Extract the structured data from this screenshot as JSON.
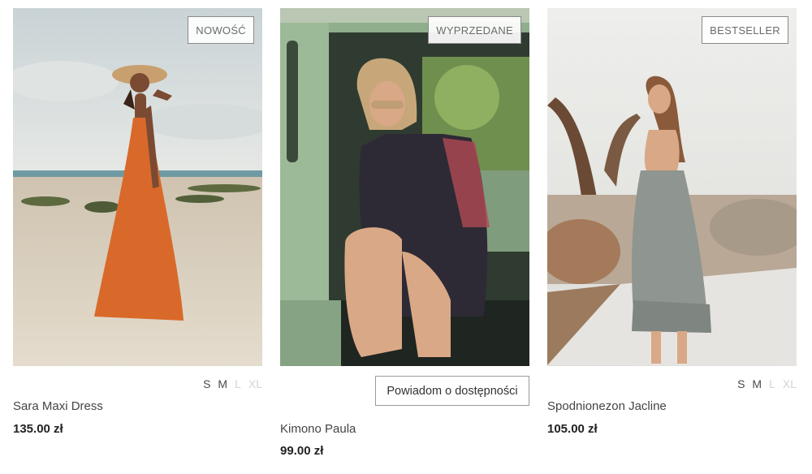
{
  "products": [
    {
      "badge": "NOWOŚĆ",
      "name": "Sara Maxi Dress",
      "price": "135.00 zł",
      "sizes": [
        {
          "label": "S",
          "available": true
        },
        {
          "label": "M",
          "available": true
        },
        {
          "label": "L",
          "available": false
        },
        {
          "label": "XL",
          "available": false
        }
      ]
    },
    {
      "badge": "WYPRZEDANE",
      "name": "Kimono Paula",
      "price": "99.00 zł",
      "notify_label": "Powiadom o dostępności"
    },
    {
      "badge": "BESTSELLER",
      "name": "Spodnionezon Jacline",
      "price": "105.00 zł",
      "sizes": [
        {
          "label": "S",
          "available": true
        },
        {
          "label": "M",
          "available": true
        },
        {
          "label": "L",
          "available": false
        },
        {
          "label": "XL",
          "available": false
        }
      ]
    }
  ],
  "colors": {
    "dress_orange": "#d9692a",
    "kimono_dark": "#2d2a35",
    "car_green": "#8fae8c",
    "skirt_grey": "#8f9590"
  }
}
